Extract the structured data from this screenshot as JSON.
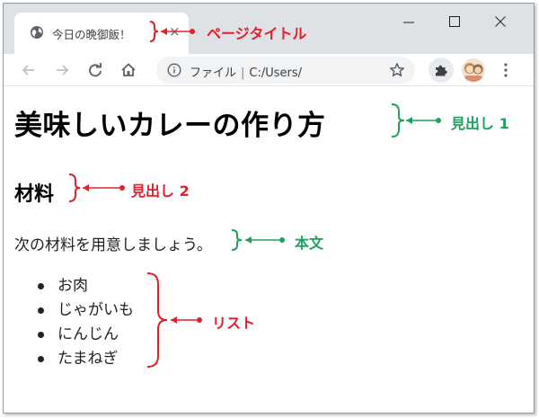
{
  "browser": {
    "tab_title": "今日の晩御飯！",
    "address_label": "ファイル",
    "address_separator": "|",
    "address_path": "C:/Users/"
  },
  "page": {
    "heading1": "美味しいカレーの作り方",
    "heading2": "材料",
    "paragraph": "次の材料を用意しましょう。",
    "list_items": [
      "お肉",
      "じゃがいも",
      "にんじん",
      "たまねぎ"
    ]
  },
  "annotations": {
    "page_title": "ページタイトル",
    "heading1": "見出し 1",
    "heading2": "見出し 2",
    "body_text": "本文",
    "list": "リスト"
  },
  "colors": {
    "annotation_red": "#e0202b",
    "annotation_green": "#1ea25e",
    "tabstrip": "#dee1e6",
    "omnibox": "#f1f3f4"
  },
  "icons": {
    "favicon": "globe-icon",
    "back": "arrow-left-icon",
    "forward": "arrow-right-icon",
    "reload": "reload-icon",
    "home": "home-icon",
    "info": "info-icon",
    "bookmark": "star-icon",
    "extensions": "puzzle-icon",
    "menu": "kebab-menu-icon"
  }
}
